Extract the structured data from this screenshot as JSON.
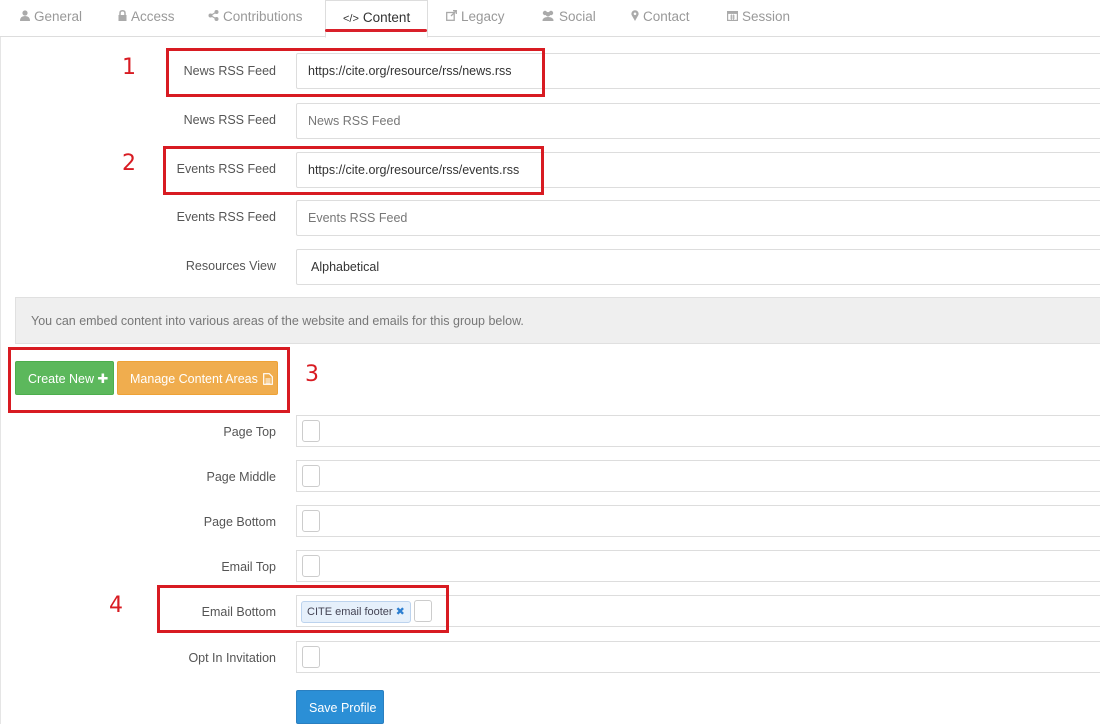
{
  "tabs": [
    {
      "label": "General",
      "icon": "user-icon"
    },
    {
      "label": "Access",
      "icon": "lock-icon"
    },
    {
      "label": "Contributions",
      "icon": "share-icon"
    },
    {
      "label": "Content",
      "icon": "code-icon"
    },
    {
      "label": "Legacy",
      "icon": "external-link-icon"
    },
    {
      "label": "Social",
      "icon": "users-icon"
    },
    {
      "label": "Contact",
      "icon": "map-marker-icon"
    },
    {
      "label": "Session",
      "icon": "calendar-icon"
    }
  ],
  "active_tab": "Content",
  "form": {
    "news_label_1": "News RSS Feed",
    "news_value": "https://cite.org/resource/rss/news.rss",
    "news_label_2": "News RSS Feed",
    "news_placeholder": "News RSS Feed",
    "events_label_1": "Events RSS Feed",
    "events_value": "https://cite.org/resource/rss/events.rss",
    "events_label_2": "Events RSS Feed",
    "events_placeholder": "Events RSS Feed",
    "resources_label": "Resources View",
    "resources_value": "Alphabetical"
  },
  "info_text": "You can embed content into various areas of the website and emails for this group below.",
  "buttons": {
    "create_new": "Create New",
    "manage": "Manage Content Areas",
    "save": "Save Profile"
  },
  "areas": [
    {
      "label": "Page Top"
    },
    {
      "label": "Page Middle"
    },
    {
      "label": "Page Bottom"
    },
    {
      "label": "Email Top"
    },
    {
      "label": "Email Bottom",
      "tag": "CITE email footer"
    },
    {
      "label": "Opt In Invitation"
    }
  ],
  "annotations": [
    "1",
    "2",
    "3",
    "4"
  ],
  "colors": {
    "annotation": "#d81b22",
    "create_button": "#5cb85c",
    "manage_button": "#f0ad4e",
    "save_button": "#2b8fd6",
    "active_tab_underline": "#d9202a"
  }
}
